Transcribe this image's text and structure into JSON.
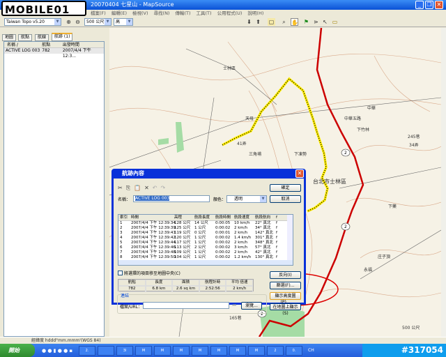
{
  "window": {
    "title": "20070404 七星山 - MapSource",
    "min": "_",
    "max": "❐",
    "close": "✕"
  },
  "watermark": {
    "logo": "MOBILE01",
    "id": "#317054"
  },
  "menu": [
    "檔案(F)",
    "編輯(E)",
    "檢視(V)",
    "尋找(N)",
    "傳輸(T)",
    "工具(T)",
    "公用程式(U)",
    "說明(H)"
  ],
  "toolbar": {
    "product": "Taiwan Topo v5.20",
    "scale": "500 公尺",
    "detail": "高",
    "zoom_in": "⊕",
    "zoom_out": "⊖"
  },
  "left_panel": {
    "tabs": [
      "地圖",
      "航點",
      "航線",
      "航跡 (1)"
    ],
    "columns": [
      "名稱 /",
      "航點",
      "出發時間"
    ],
    "rows": [
      {
        "name": "ACTIVE LOG 003",
        "points": "782",
        "start": "2007/4/4 下午 12:3..."
      }
    ]
  },
  "map": {
    "labels": [
      "士林區",
      "天母",
      "41弄",
      "三角埔",
      "下凍勢",
      "中華五路",
      "下竹林",
      "台北市士林區",
      "永福",
      "庄子頂",
      "165巷",
      "中華",
      "下藥",
      "245巷",
      "34弄"
    ],
    "road_number": "2",
    "scale_text": "500 公尺"
  },
  "dialog": {
    "title": "航跡內容",
    "ok": "確定",
    "cancel": "取消",
    "name_label": "名稱：",
    "name_value": "ACTIVE LOG 003",
    "color_label": "顏色：",
    "color_value": "透明",
    "columns": [
      "索引",
      "時間",
      "高程",
      "航段長度",
      "航段時間",
      "航段速度",
      "航段航向",
      "f"
    ],
    "rows": [
      [
        "1",
        "2007/4/4 下午 12:39:34",
        "128 公尺",
        "14 公尺",
        "0:00:05",
        "10 km/h",
        "22° 真北",
        "f"
      ],
      [
        "2",
        "2007/4/4 下午 12:39:39",
        "125 公尺",
        "1 公尺",
        "0:00:02",
        "2 km/h",
        "34° 真北",
        "f"
      ],
      [
        "3",
        "2007/4/4 下午 12:39:41",
        "119 公尺",
        "0 公尺",
        "0:00:01",
        "2 km/h",
        "142° 真北",
        "f"
      ],
      [
        "4",
        "2007/4/4 下午 12:39:42",
        "120 公尺",
        "1 公尺",
        "0:00:02",
        "1.4 km/h",
        "301° 真北",
        "f"
      ],
      [
        "5",
        "2007/4/4 下午 12:39:44",
        "117 公尺",
        "1 公尺",
        "0:00:02",
        "2 km/h",
        "348° 真北",
        "f"
      ],
      [
        "6",
        "2007/4/4 下午 12:39:46",
        "113 公尺",
        "2 公尺",
        "0:00:02",
        "3 km/h",
        "57° 真北",
        "f"
      ],
      [
        "7",
        "2007/4/4 下午 12:39:48",
        "109 公尺",
        "1 公尺",
        "0:00:02",
        "2 km/h",
        "42° 真北",
        "f"
      ],
      [
        "8",
        "2007/4/4 下午 12:39:50",
        "104 公尺",
        "1 公尺",
        "0:00:02",
        "1.2 km/h",
        "130° 真北",
        "f"
      ]
    ],
    "center_checkbox": "將選擇的項目移至地圖中央(C)",
    "stats_headers": [
      "航點",
      "長度",
      "面積",
      "航程計時",
      "平均 倍速"
    ],
    "stats_values": [
      "782",
      "6.8 km",
      "2.6 sq km",
      "2:52:56",
      "2 km/h"
    ],
    "reverse": "反向(I)",
    "filter": "篩選(F)...",
    "profile": "顯示高度圖(P)...",
    "show_on_map": "在地圖上顯示(S)",
    "link_group": "連結",
    "file_url_label": "檔案/URL：",
    "file_url_value": "",
    "browse": "瀏覽..."
  },
  "status": {
    "text": "經緯度 hddd°mm.mmm'(WGS 84)"
  },
  "taskbar": {
    "start": "開始",
    "tasks": [
      "2.",
      "",
      "3l",
      "M",
      "M",
      "M",
      "M",
      "M",
      "M",
      "M",
      "2",
      "0."
    ],
    "ime": "CH"
  }
}
